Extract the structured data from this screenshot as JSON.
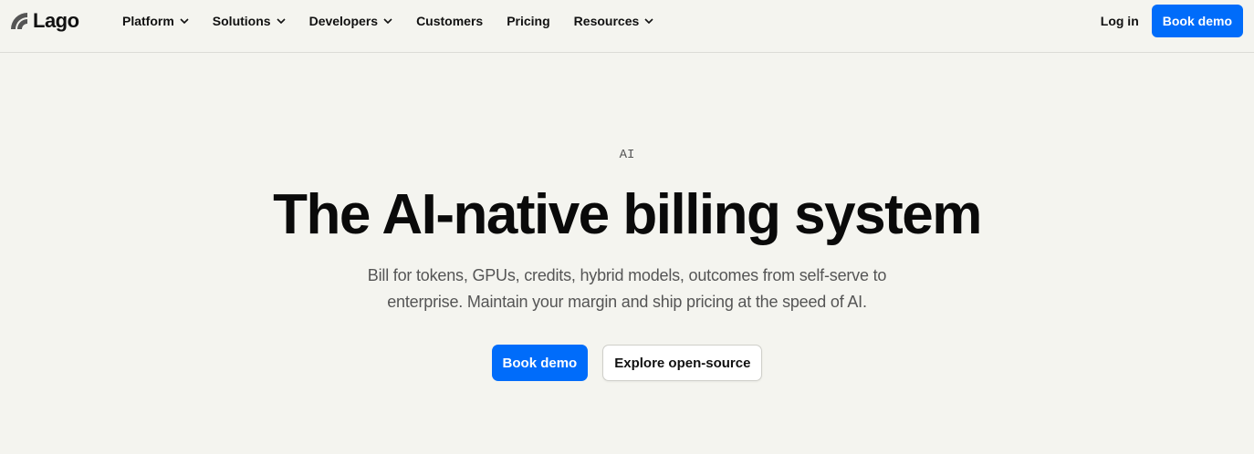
{
  "brand": {
    "name": "Lago",
    "logo_icon": "lago-logo-icon"
  },
  "nav": {
    "items": [
      {
        "label": "Platform",
        "has_dropdown": true
      },
      {
        "label": "Solutions",
        "has_dropdown": true
      },
      {
        "label": "Developers",
        "has_dropdown": true
      },
      {
        "label": "Customers",
        "has_dropdown": false
      },
      {
        "label": "Pricing",
        "has_dropdown": false
      },
      {
        "label": "Resources",
        "has_dropdown": true
      }
    ],
    "login_label": "Log in",
    "book_demo_label": "Book demo"
  },
  "hero": {
    "eyebrow": "AI",
    "headline": "The AI-native billing system",
    "subheadline": "Bill for tokens, GPUs, credits, hybrid models, outcomes from self-serve to enterprise. Maintain your margin and ship pricing at the speed of AI.",
    "primary_cta": "Book demo",
    "secondary_cta": "Explore open-source"
  },
  "colors": {
    "accent": "#006cfa",
    "background": "#f4f4ef",
    "text": "#0e0e0e"
  }
}
